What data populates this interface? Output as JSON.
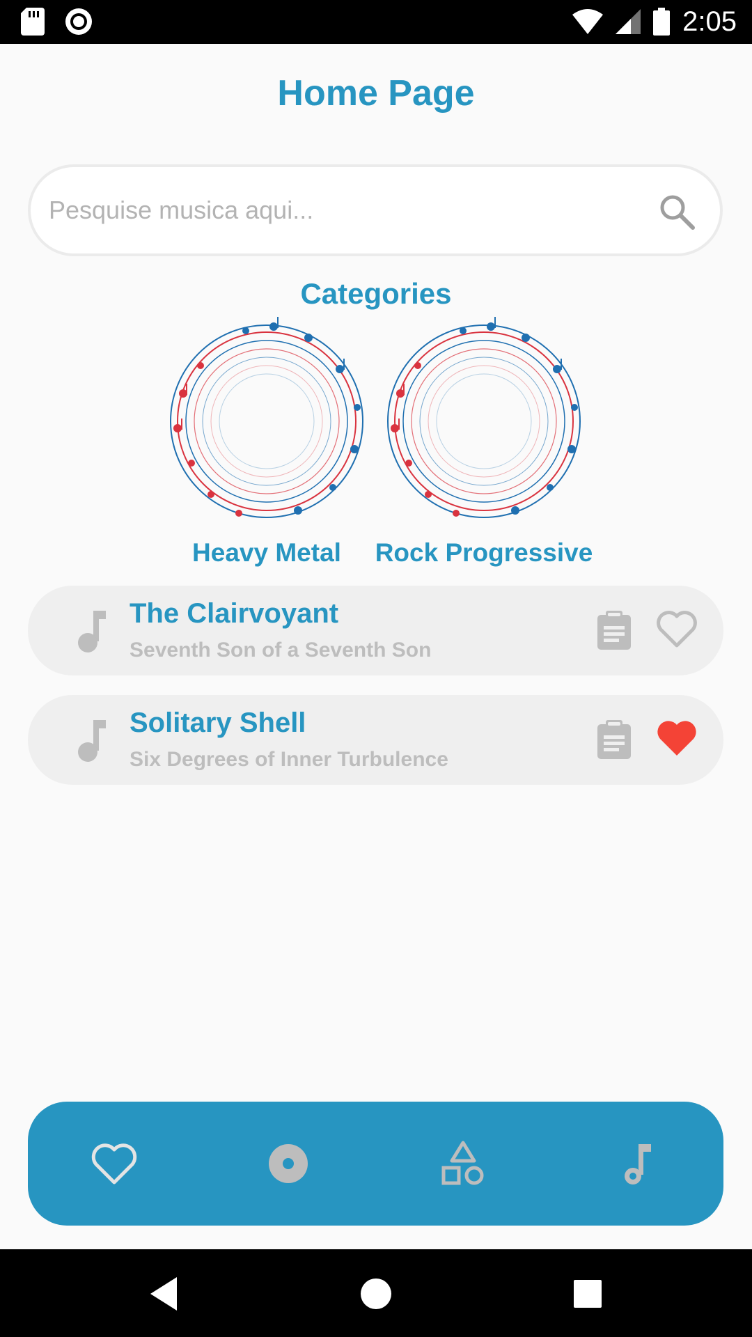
{
  "status_bar": {
    "time": "2:05",
    "icons": [
      "sd-card-icon",
      "record-icon",
      "wifi-icon",
      "signal-icon",
      "battery-icon"
    ]
  },
  "header": {
    "title": "Home Page"
  },
  "search": {
    "placeholder": "Pesquise musica aqui...",
    "value": "",
    "icon": "search-icon"
  },
  "categories": {
    "title": "Categories",
    "items": [
      {
        "label": "Heavy Metal",
        "image": "music-notes-circle"
      },
      {
        "label": "Rock Progressive",
        "image": "music-notes-circle"
      }
    ]
  },
  "songs": [
    {
      "title": "The Clairvoyant",
      "album": "Seventh Son of a Seventh Son",
      "favorite": false
    },
    {
      "title": "Solitary Shell",
      "album": "Six Degrees of Inner Turbulence",
      "favorite": true
    }
  ],
  "bottom_nav": {
    "items": [
      "heart-icon",
      "disc-icon",
      "shapes-icon",
      "music-note-icon"
    ]
  },
  "colors": {
    "accent": "#2795c1",
    "favorite": "#f44336",
    "muted": "#bdbdbd",
    "card_bg": "#efefef"
  }
}
